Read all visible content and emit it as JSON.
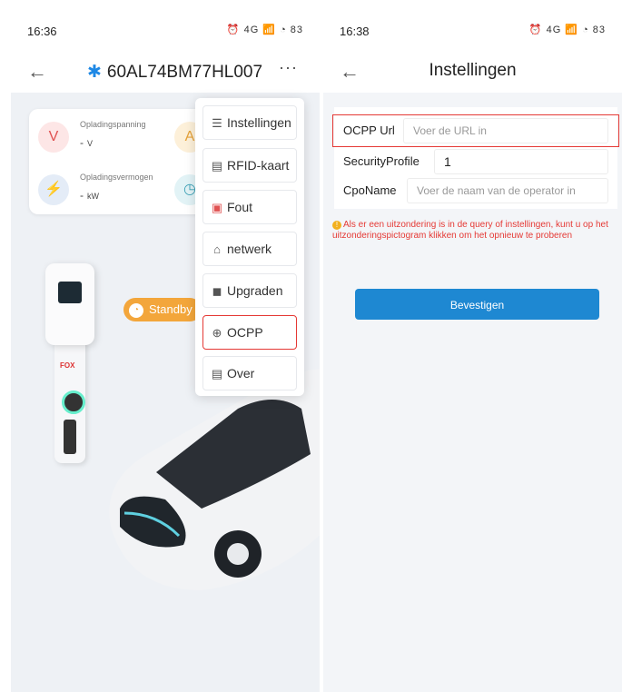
{
  "left": {
    "status": {
      "time": "16:36",
      "icons": "⏰ 4G 📶 ◔ 83"
    },
    "header": {
      "bluetooth_icon": "bluetooth-icon",
      "title": "60AL74BM77HL007",
      "more": "···"
    },
    "stats": [
      {
        "label": "Opladingspanning",
        "value": "-",
        "unit": "V"
      },
      {
        "label": "Opladingsvermogen",
        "value": "-",
        "unit": "kW"
      }
    ],
    "charger_brand": "FOX",
    "status_badge": "Standby",
    "menu": [
      {
        "icon": "settings-icon",
        "label": "Instellingen"
      },
      {
        "icon": "card-icon",
        "label": "RFID-kaart"
      },
      {
        "icon": "fault-icon",
        "label": "Fout"
      },
      {
        "icon": "network-icon",
        "label": "netwerk"
      },
      {
        "icon": "upgrade-icon",
        "label": "Upgraden"
      },
      {
        "icon": "globe-icon",
        "label": "OCPP"
      },
      {
        "icon": "info-icon",
        "label": "Over"
      }
    ]
  },
  "right": {
    "status": {
      "time": "16:38",
      "icons": "⏰ 4G 📶 ◔ 83"
    },
    "header": {
      "title": "Instellingen"
    },
    "form": {
      "ocpp_url": {
        "label": "OCPP Url",
        "value": "",
        "placeholder": "Voer de URL in"
      },
      "security_profile": {
        "label": "SecurityProfile",
        "value": "1",
        "placeholder": ""
      },
      "cpo_name": {
        "label": "CpoName",
        "value": "",
        "placeholder": "Voer de naam van de operator in"
      }
    },
    "warning": "Als er een uitzondering is in de query of instellingen, kunt u op het uitzonderingspictogram klikken om het opnieuw te proberen",
    "confirm_label": "Bevestigen"
  },
  "colors": {
    "accent": "#1e88d2",
    "highlight": "#e53935",
    "standby": "#f3a63b",
    "warning_text": "#e53935"
  }
}
